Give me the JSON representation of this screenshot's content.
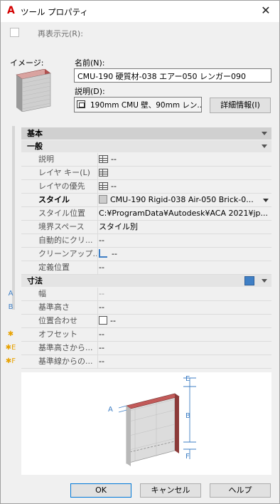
{
  "window": {
    "title": "ツール プロパティ",
    "close_glyph": "✕"
  },
  "redisplay": {
    "label": "再表示元(R):",
    "checked": false
  },
  "image": {
    "label": "イメージ:"
  },
  "name": {
    "label": "名前(N):",
    "value": "CMU-190 硬質材-038 エアー050 レンガー090"
  },
  "description": {
    "label": "説明(D):",
    "value": "190mm CMU 壁、90mm レン...",
    "details_button": "詳細情報(I)"
  },
  "properties": {
    "category": "基本",
    "general": {
      "header": "一般",
      "rows": [
        {
          "label": "説明",
          "value": "--"
        },
        {
          "label": "レイヤ キー(L)",
          "value": ""
        },
        {
          "label": "レイヤの優先",
          "value": "--"
        },
        {
          "label": "スタイル",
          "value": "CMU-190 Rigid-038 Air-050 Brick-0..."
        },
        {
          "label": "スタイル位置",
          "value": "C:¥ProgramData¥Autodesk¥ACA  2021¥jp..."
        },
        {
          "label": "境界スペース",
          "value": "スタイル別"
        },
        {
          "label": "自動的にクリ...",
          "value": "--"
        },
        {
          "label": "クリーンアップ...",
          "value": "--"
        },
        {
          "label": "定義位置",
          "value": "--"
        }
      ]
    },
    "dimensions": {
      "header": "寸法",
      "rows": [
        {
          "marker": "A",
          "label": "幅",
          "value": "--"
        },
        {
          "marker": "B",
          "label": "基準高さ",
          "value": "--"
        },
        {
          "marker": "",
          "label": "位置合わせ",
          "value": "--"
        },
        {
          "marker": "✱",
          "label": "オフセット",
          "value": "--"
        },
        {
          "marker": "✱E",
          "label": "基準高さから...",
          "value": "--"
        },
        {
          "marker": "✱F",
          "label": "基準線からの...",
          "value": "--"
        }
      ]
    }
  },
  "diagram": {
    "labels": [
      "E",
      "A",
      "B",
      "F"
    ]
  },
  "buttons": {
    "ok": "OK",
    "cancel": "キャンセル",
    "help": "ヘルプ"
  },
  "colors": {
    "logo": "#d40000",
    "accent": "#3f7fc5",
    "brick": "#b0504f",
    "dim_marker": "#3f7fc5",
    "star": "#e8a200"
  }
}
